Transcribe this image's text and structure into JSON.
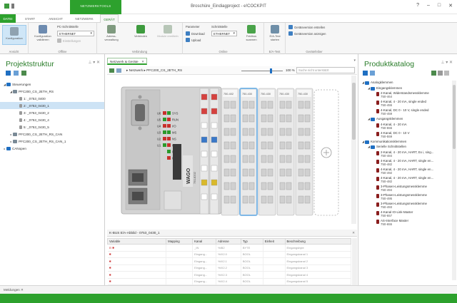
{
  "window": {
    "title": "Broschüre_Eindiagproject - e!COCKPIT",
    "context_tab": "NETZWERKTOOLS",
    "controls": [
      "?",
      "–",
      "□",
      "✕"
    ]
  },
  "ribbon_tabs": {
    "file": "DATEI",
    "start": "START",
    "view": "ANSICHT",
    "network": "NETZWERK",
    "device": "GERÄT"
  },
  "ribbon": {
    "ansicht": {
      "label": "Ansicht",
      "configuration": "Konfiguration"
    },
    "offline": {
      "label": "Offline",
      "validate": "Konfiguration validieren",
      "pc_interface_label": "PC-Schnittstelle",
      "pc_interface_value": "ETHERNET",
      "settings": "Einstellungen"
    },
    "verbindung": {
      "label": "Verbindung",
      "address": "Adress-verwaltung",
      "connect": "Verbinden",
      "modules": "Module ermitteln"
    },
    "online": {
      "label": "Online",
      "params": "Parameter",
      "download": "Download",
      "upload": "Upload",
      "interface_label": "Schnittstelle",
      "interface_value": "ETHERNET",
      "fieldbus": "Feldbus scannen",
      "ea_check": "E/A-Test starten"
    },
    "ea_test": {
      "label": "E/A-Test"
    },
    "geraetefeiber": {
      "label": "Gerätefeiber",
      "create": "Geräteversion erstellen",
      "show": "Geräteversion anzeigen"
    }
  },
  "left_panel": {
    "title": "Projektstruktur",
    "tree": [
      {
        "label": "Steuerungen",
        "level": 0,
        "type": "folder",
        "expander": "◢"
      },
      {
        "label": "PFC200_CS_2ETH_RS",
        "level": 1,
        "type": "ctrl",
        "expander": "◢"
      },
      {
        "label": "1: _0753_0400",
        "level": 2,
        "type": "mod",
        "expander": ""
      },
      {
        "label": "2: _0753_0430_1",
        "level": 2,
        "type": "mod",
        "expander": "",
        "selected": true
      },
      {
        "label": "3: _0753_0430_2",
        "level": 2,
        "type": "mod",
        "expander": ""
      },
      {
        "label": "4: _0753_0430_4",
        "level": 2,
        "type": "mod",
        "expander": ""
      },
      {
        "label": "5: _0753_0430_5",
        "level": 2,
        "type": "mod",
        "expander": ""
      },
      {
        "label": "PFC200_CS_2ETH_RS_CAN",
        "level": 1,
        "type": "ctrl",
        "expander": "▸"
      },
      {
        "label": "PFC200_CS_2ETH_RS_CAN_1",
        "level": 1,
        "type": "ctrl",
        "expander": "▸"
      },
      {
        "label": "CANopen",
        "level": 0,
        "type": "folder",
        "expander": "▸"
      }
    ]
  },
  "center": {
    "doc_tab": "Netzwerk & Geräte",
    "breadcrumb": "▸ Netzwerk ▸ PFC200_CS_2ETH_RS",
    "zoom": "100 %",
    "search_placeholder": "Suche nicht unterstützt",
    "device": {
      "brand": "WAGO",
      "model": "750-8202",
      "led_labels": [
        "SYS",
        "RUN",
        "I/O",
        "MS",
        "NS",
        "U7",
        "U6",
        "U5"
      ],
      "led_left": [
        "U6",
        "U5",
        "U4",
        "U3",
        "U2",
        "U1"
      ],
      "module_heads": [
        "750-402",
        "750-430",
        "750-430",
        "750-430",
        "750-430"
      ]
    },
    "io_header": "K-BUS E/A-Abbild - 0753_0430_1",
    "io_columns": [
      "Variable",
      "Mapping",
      "Kanal",
      "Adresse",
      "Typ",
      "Einheit",
      "Beschreibung"
    ],
    "io_rows": [
      {
        "icon": "⊟ ✱",
        "variable": "",
        "mapping": "",
        "kanal": "_IN",
        "adresse": "%IB2",
        "typ": "BYTE",
        "einheit": "",
        "beschreibung": "Eingangsbyte"
      },
      {
        "icon": "✱",
        "variable": "",
        "mapping": "",
        "kanal": "Eingang...",
        "adresse": "%IX2.0",
        "typ": "BOOL",
        "einheit": "",
        "beschreibung": "Eingangskanal 1"
      },
      {
        "icon": "✱",
        "variable": "",
        "mapping": "",
        "kanal": "Eingang...",
        "adresse": "%IX2.1",
        "typ": "BOOL",
        "einheit": "",
        "beschreibung": "Eingangskanal 2"
      },
      {
        "icon": "✱",
        "variable": "",
        "mapping": "",
        "kanal": "Eingang...",
        "adresse": "%IX2.2",
        "typ": "BOOL",
        "einheit": "",
        "beschreibung": "Eingangskanal 3"
      },
      {
        "icon": "✱",
        "variable": "",
        "mapping": "",
        "kanal": "Eingang...",
        "adresse": "%IX2.3",
        "typ": "BOOL",
        "einheit": "",
        "beschreibung": "Eingangskanal 4"
      },
      {
        "icon": "✱",
        "variable": "",
        "mapping": "",
        "kanal": "Eingang...",
        "adresse": "%IX2.4",
        "typ": "BOOL",
        "einheit": "",
        "beschreibung": "Eingangskanal 5"
      }
    ]
  },
  "right_panel": {
    "title": "Produktkatalog",
    "items": [
      {
        "label": "Analogklemmen",
        "level": 0,
        "type": "folder",
        "expander": "◢"
      },
      {
        "label": "Eingangsklemmen",
        "level": 1,
        "type": "folder",
        "expander": "◢"
      },
      {
        "label": "2-Kanal, Widerstandsmessklemme",
        "sub": "750-464",
        "level": 2,
        "type": "mod"
      },
      {
        "label": "4-Kanal, 4 - 20 mA, single ended",
        "sub": "750-455",
        "level": 2,
        "type": "mod"
      },
      {
        "label": "4-Kanal, DC 0 - 10 V, single ended",
        "sub": "750-459",
        "level": 2,
        "type": "mod"
      },
      {
        "label": "Ausgangsklemmen",
        "level": 1,
        "type": "folder",
        "expander": "◢"
      },
      {
        "label": "4-Kanal, 4 - 20 mA",
        "sub": "750-555",
        "level": 2,
        "type": "mod"
      },
      {
        "label": "4-Kanal, DC 0 - 10 V",
        "sub": "750-559",
        "level": 2,
        "type": "mod"
      },
      {
        "label": "Kommunikationsklemmen",
        "level": 0,
        "type": "folder",
        "expander": "◢"
      },
      {
        "label": "Serielle Schnittstellen",
        "level": 1,
        "type": "folder",
        "expander": "◢"
      },
      {
        "label": "2-Kanal, 4 - 20 mA, HART, Ex i, sing...",
        "sub": "750-484",
        "level": 2,
        "type": "mod"
      },
      {
        "label": "4-Kanal, 4 - 20 mA, HART, single en...",
        "sub": "750-482",
        "level": 2,
        "type": "mod"
      },
      {
        "label": "4-Kanal, 4 - 20 mA, HART, single en...",
        "sub": "750-492",
        "level": 2,
        "type": "mod"
      },
      {
        "label": "4-Kanal, 4 - 20 mA, HART, single en...",
        "sub": "750-482",
        "level": 2,
        "type": "mod"
      },
      {
        "label": "3-Phasen-Leistungsmessklemme",
        "sub": "750-494",
        "level": 2,
        "type": "mod"
      },
      {
        "label": "3-Phasen-Leistungsmessklemme",
        "sub": "750-495",
        "level": 2,
        "type": "mod"
      },
      {
        "label": "3-Phasen-Leistungsmessklemme",
        "sub": "750-493",
        "level": 2,
        "type": "mod"
      },
      {
        "label": "4-Kanal IO-Link-Master",
        "sub": "750-657",
        "level": 2,
        "type": "mod"
      },
      {
        "label": "AS-Interface Master",
        "sub": "750-655",
        "level": 2,
        "type": "mod"
      }
    ]
  },
  "message_bar": {
    "label": "Meldungen"
  },
  "colors": {
    "accent": "#2da12d",
    "selection": "#cde3f5",
    "folder": "#1f6fc2",
    "highlight": "#7fb8e6"
  }
}
